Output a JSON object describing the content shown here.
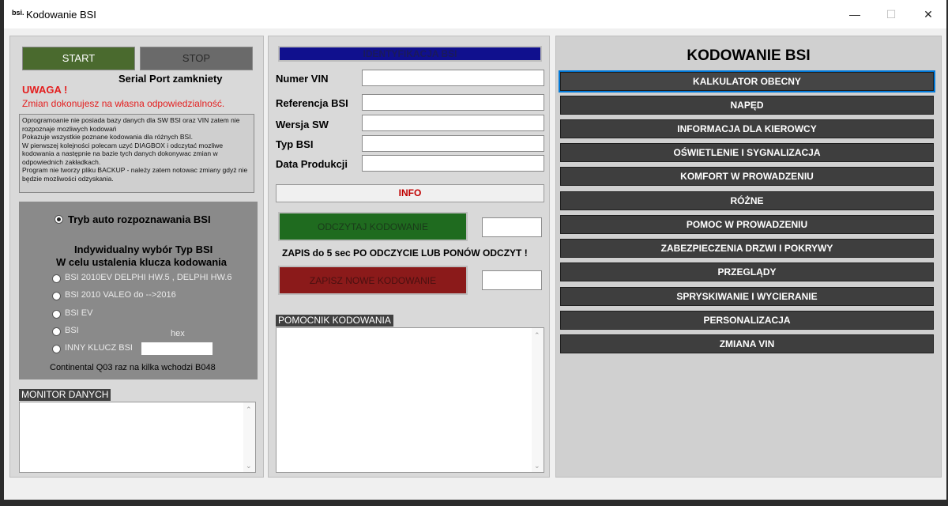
{
  "window": {
    "title": "Kodowanie BSI",
    "icon_text": "bsi."
  },
  "controls": {
    "minimize": "—",
    "maximize": "☐",
    "close": "✕"
  },
  "left": {
    "start_label": "START",
    "stop_label": "STOP",
    "port_status": "Serial Port zamkniety",
    "warning_title": "UWAGA !",
    "warning_text": "Zmian dokonujesz na własna odpowiedzialność.",
    "info_text": "Oprogramoanie nie posiada bazy danych dla SW BSI oraz VIN zatem nie rozpoznaje mozliwych kodowań\nPokazuje wszystkie poznane kodowania dla różnych BSI.\nW pierwszej kolejności polecam uzyć DIAGBOX i odczytać mozliwe kodowania a następnie na bazie tych danych dokonywac zmian w odpowiednich zakładkach.\nProgram nie tworzy pliku BACKUP - należy zatem notowac zmiany gdyż nie będzie mozliwości odzyskania.",
    "auto_mode_label": "Tryb auto rozpoznawania BSI",
    "individual_title_1": "Indywidualny wybór Typ BSI",
    "individual_title_2": "W celu ustalenia klucza kodowania",
    "options": [
      "BSI 2010EV DELPHI HW.5 , DELPHI HW.6",
      "BSI 2010 VALEO do -->2016",
      "BSI EV",
      "BSI",
      "INNY KLUCZ BSI"
    ],
    "hex_label": "hex",
    "hex_value": "",
    "continental_note": "Continental Q03 raz na kilka wchodzi B048",
    "monitor_caption": "MONITOR DANYCH"
  },
  "middle": {
    "identification_header": "IDENTYFIKACJA BSI",
    "fields": [
      {
        "label": "Numer VIN",
        "value": ""
      },
      {
        "label": "Referencja BSI",
        "value": ""
      },
      {
        "label": "Wersja SW",
        "value": ""
      },
      {
        "label": "Typ BSI",
        "value": ""
      },
      {
        "label": "Data Produkcji",
        "value": ""
      }
    ],
    "info_label": "INFO",
    "read_label": "ODCZYTAJ KODOWANIE",
    "read_value": "",
    "save_note": "ZAPIS do 5 sec PO ODCZYCIE LUB PONÓW ODCZYT !",
    "write_label": "ZAPISZ NOWE KODOWANIE",
    "write_value": "",
    "helper_caption": "POMOCNIK KODOWANIA"
  },
  "right": {
    "title": "KODOWANIE BSI",
    "menu": [
      "KALKULATOR OBECNY",
      "NAPĘD",
      "INFORMACJA DLA KIEROWCY",
      "OŚWIETLENIE I SYGNALIZACJA",
      "KOMFORT W PROWADZENIU",
      "RÓŻNE",
      "POMOC W PROWADZENIU",
      "ZABEZPIECZENIA DRZWI I POKRYWY",
      "PRZEGLĄDY",
      "SPRYSKIWANIE I WYCIERANIE",
      "PERSONALIZACJA",
      "ZMIANA VIN"
    ]
  },
  "colors": {
    "start_green": "#4a6a2e",
    "stop_gray": "#6a6a6a",
    "read_green": "#1f6b1f",
    "write_red": "#8b1a1a",
    "id_blue": "#10108e",
    "warning_red": "#e31e1e",
    "info_red": "#c00000"
  }
}
